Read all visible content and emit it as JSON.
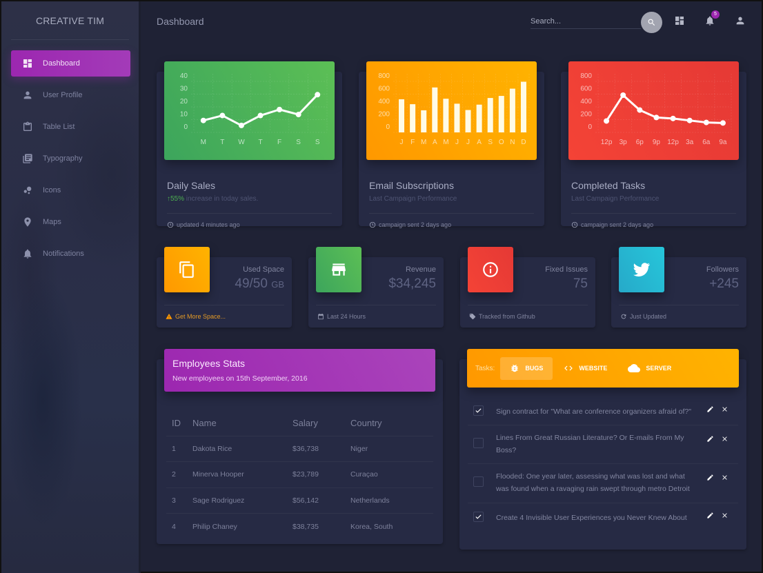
{
  "sidebar": {
    "brand": "CREATIVE TIM",
    "items": [
      {
        "label": "Dashboard",
        "icon": "dashboard-icon",
        "active": true
      },
      {
        "label": "User Profile",
        "icon": "person-icon"
      },
      {
        "label": "Table List",
        "icon": "clipboard-icon"
      },
      {
        "label": "Typography",
        "icon": "library-books-icon"
      },
      {
        "label": "Icons",
        "icon": "bubble-chart-icon"
      },
      {
        "label": "Maps",
        "icon": "location-pin-icon"
      },
      {
        "label": "Notifications",
        "icon": "bell-icon"
      }
    ]
  },
  "topbar": {
    "title": "Dashboard",
    "search_placeholder": "Search...",
    "notification_count": "5",
    "icons": [
      "search-icon",
      "dashboard-icon",
      "bell-icon",
      "person-icon"
    ]
  },
  "chart_cards": [
    {
      "title": "Daily Sales",
      "highlight": "55%",
      "category": " increase in today sales.",
      "footer": "updated 4 minutes ago",
      "color": "#4caf50"
    },
    {
      "title": "Email Subscriptions",
      "category": "Last Campaign Performance",
      "footer": "campaign sent 2 days ago",
      "color": "#ff9800"
    },
    {
      "title": "Completed Tasks",
      "category": "Last Campaign Performance",
      "footer": "campaign sent 2 days ago",
      "color": "#f44336"
    }
  ],
  "chart_data": [
    {
      "type": "line",
      "title": "Daily Sales",
      "categories": [
        "M",
        "T",
        "W",
        "T",
        "F",
        "S",
        "S"
      ],
      "values": [
        12,
        17,
        7,
        17,
        23,
        18,
        38
      ],
      "yticks": [
        "40",
        "30",
        "20",
        "10",
        "0"
      ],
      "ylim": [
        0,
        50
      ],
      "grid": true
    },
    {
      "type": "bar",
      "title": "Email Subscriptions",
      "categories": [
        "J",
        "F",
        "M",
        "A",
        "M",
        "J",
        "J",
        "A",
        "S",
        "O",
        "N",
        "D"
      ],
      "values": [
        542,
        443,
        320,
        780,
        553,
        453,
        326,
        434,
        568,
        610,
        756,
        895
      ],
      "yticks": [
        "800",
        "600",
        "400",
        "200",
        "0"
      ],
      "ylim": [
        0,
        1000
      ],
      "grid": true
    },
    {
      "type": "line",
      "title": "Completed Tasks",
      "categories": [
        "12p",
        "3p",
        "6p",
        "9p",
        "12p",
        "3a",
        "6a",
        "9a"
      ],
      "values": [
        230,
        750,
        450,
        300,
        280,
        240,
        200,
        190
      ],
      "yticks": [
        "800",
        "600",
        "400",
        "200",
        "0"
      ],
      "ylim": [
        0,
        1000
      ],
      "grid": true
    }
  ],
  "stats": [
    {
      "category": "Used Space",
      "value": "49/50",
      "unit": "GB",
      "footer": "Get More Space...",
      "icon": "content-copy-icon",
      "footer_icon": "warning-icon",
      "color": "#ff9800"
    },
    {
      "category": "Revenue",
      "value": "$34,245",
      "unit": "",
      "footer": "Last 24 Hours",
      "icon": "store-icon",
      "footer_icon": "calendar-icon",
      "color": "#4caf50"
    },
    {
      "category": "Fixed Issues",
      "value": "75",
      "unit": "",
      "footer": "Tracked from Github",
      "icon": "info-icon",
      "footer_icon": "tag-icon",
      "color": "#f44336"
    },
    {
      "category": "Followers",
      "value": "+245",
      "unit": "",
      "footer": "Just Updated",
      "icon": "twitter-icon",
      "footer_icon": "refresh-icon",
      "color": "#00bcd4"
    }
  ],
  "employees": {
    "title": "Employees Stats",
    "subtitle": "New employees on 15th September, 2016",
    "columns": [
      "ID",
      "Name",
      "Salary",
      "Country"
    ],
    "rows": [
      [
        "1",
        "Dakota Rice",
        "$36,738",
        "Niger"
      ],
      [
        "2",
        "Minerva Hooper",
        "$23,789",
        "Curaçao"
      ],
      [
        "3",
        "Sage Rodriguez",
        "$56,142",
        "Netherlands"
      ],
      [
        "4",
        "Philip Chaney",
        "$38,735",
        "Korea, South"
      ]
    ]
  },
  "tasks": {
    "label": "Tasks:",
    "tabs": [
      {
        "label": "BUGS",
        "icon": "bug-icon",
        "active": true
      },
      {
        "label": "WEBSITE",
        "icon": "code-icon"
      },
      {
        "label": "SERVER",
        "icon": "cloud-icon"
      }
    ],
    "items": [
      {
        "text": "Sign contract for \"What are conference organizers afraid of?\"",
        "checked": true
      },
      {
        "text": "Lines From Great Russian Literature? Or E-mails From My Boss?",
        "checked": false
      },
      {
        "text": "Flooded: One year later, assessing what was lost and what was found when a ravaging rain swept through metro Detroit",
        "checked": false
      },
      {
        "text": "Create 4 Invisible User Experiences you Never Knew About",
        "checked": true
      }
    ]
  }
}
